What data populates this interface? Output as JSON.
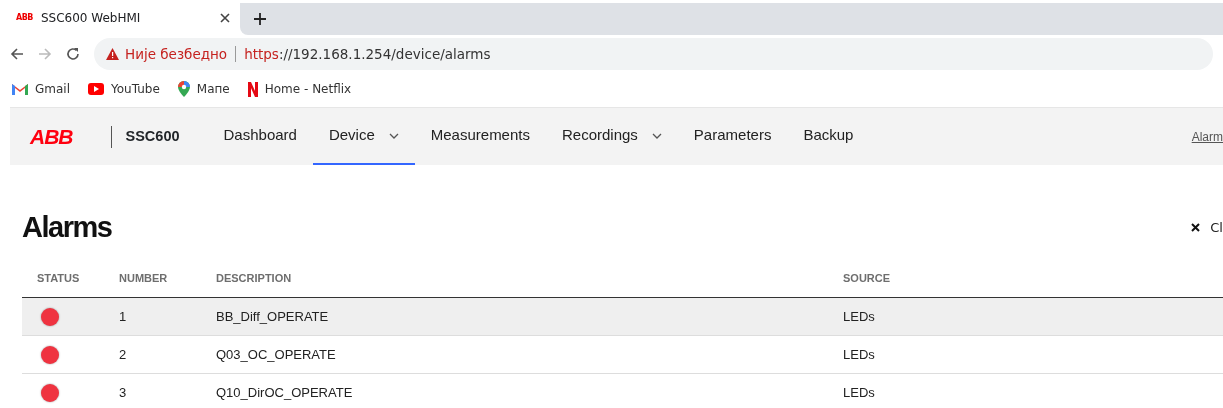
{
  "browser": {
    "tab": {
      "title": "SSC600 WebHMI",
      "favicon": "ABB",
      "selected": true
    },
    "address": {
      "security": "Није безбедно",
      "scheme": "https",
      "rest": "://192.168.1.254/device/alarms"
    },
    "bookmarks": [
      {
        "label": "Gmail",
        "kind": "gmail"
      },
      {
        "label": "YouTube",
        "kind": "youtube"
      },
      {
        "label": "Мапе",
        "kind": "maps"
      },
      {
        "label": "Home - Netflix",
        "kind": "netflix"
      }
    ]
  },
  "app": {
    "logo": "ABB",
    "product": "SSC600",
    "nav": [
      {
        "label": "Dashboard",
        "selected": false,
        "dropdown": false
      },
      {
        "label": "Device",
        "selected": true,
        "dropdown": true
      },
      {
        "label": "Measurements",
        "selected": false,
        "dropdown": false
      },
      {
        "label": "Recordings",
        "selected": false,
        "dropdown": true
      },
      {
        "label": "Parameters",
        "selected": false,
        "dropdown": false
      },
      {
        "label": "Backup",
        "selected": false,
        "dropdown": false
      }
    ],
    "right_link": "Alarm"
  },
  "page": {
    "title": "Alarms",
    "action": "Cl"
  },
  "table": {
    "columns": [
      "STATUS",
      "NUMBER",
      "DESCRIPTION",
      "SOURCE"
    ],
    "rows": [
      {
        "color": "#ef3340",
        "number": "1",
        "description": "BB_Diff_OPERATE",
        "source": "LEDs",
        "highlighted": true
      },
      {
        "color": "#ef3340",
        "number": "2",
        "description": "Q03_OC_OPERATE",
        "source": "LEDs",
        "highlighted": false
      },
      {
        "color": "#ef3340",
        "number": "3",
        "description": "Q10_DirOC_OPERATE",
        "source": "LEDs",
        "highlighted": false
      }
    ]
  }
}
